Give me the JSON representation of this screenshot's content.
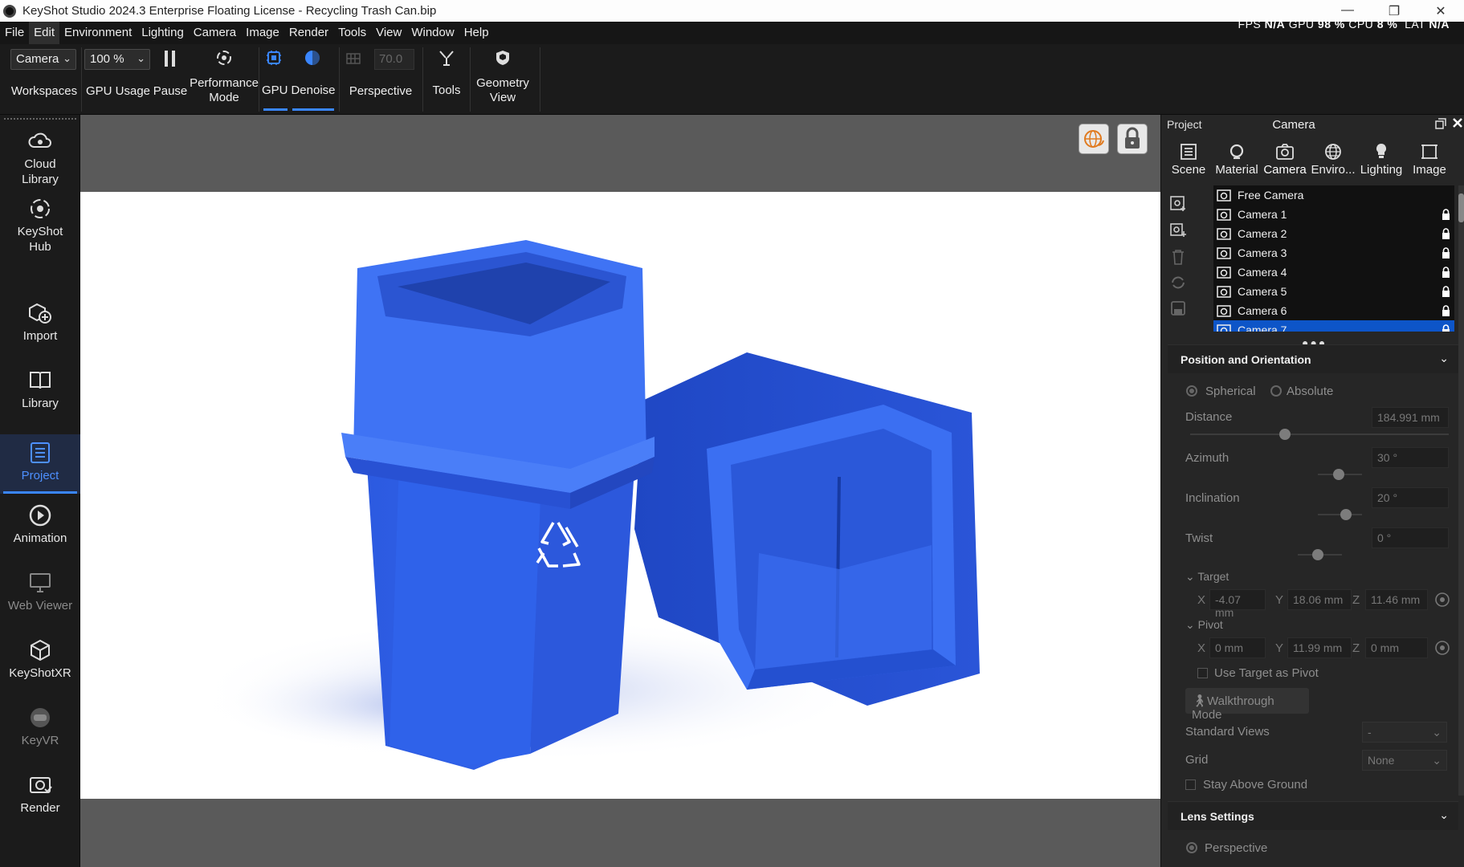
{
  "window": {
    "title": "KeyShot Studio 2024.3 Enterprise Floating License  - Recycling Trash Can.bip",
    "minimize": "—",
    "maximize": "❐",
    "close": "✕"
  },
  "menu": [
    "File",
    "Edit",
    "Environment",
    "Lighting",
    "Camera",
    "Image",
    "Render",
    "Tools",
    "View",
    "Window",
    "Help"
  ],
  "stats": {
    "fps_label": "FPS",
    "fps": "N/A",
    "gpu_label": "GPU",
    "gpu": "98 %",
    "cpu_label": "CPU",
    "cpu": "8 %",
    "lat_label": "LAT",
    "lat": "N/A"
  },
  "toolbar": {
    "workspace_select": "Camera",
    "workspaces_label": "Workspaces",
    "gpu_usage_select": "100 %",
    "gpu_usage_label": "GPU Usage",
    "pause_label": "Pause",
    "performance_label_1": "Performance",
    "performance_label_2": "Mode",
    "gpu_label": "GPU",
    "denoise_label": "Denoise",
    "fov_value": "70.0",
    "perspective_label": "Perspective",
    "tools_label": "Tools",
    "geometry_label_1": "Geometry",
    "geometry_label_2": "View"
  },
  "sidebar": {
    "items": [
      {
        "line1": "Cloud",
        "line2": "Library"
      },
      {
        "line1": "KeyShot",
        "line2": "Hub"
      },
      {
        "line1": "Import",
        "line2": ""
      },
      {
        "line1": "Library",
        "line2": ""
      },
      {
        "line1": "Project",
        "line2": ""
      },
      {
        "line1": "Animation",
        "line2": ""
      },
      {
        "line1": "Web Viewer",
        "line2": ""
      },
      {
        "line1": "KeyShotXR",
        "line2": ""
      },
      {
        "line1": "KeyVR",
        "line2": ""
      },
      {
        "line1": "Render",
        "line2": ""
      }
    ],
    "active_item": "Project"
  },
  "panel": {
    "header_left": "Project",
    "header_title": "Camera",
    "tabs": [
      "Scene",
      "Material",
      "Camera",
      "Enviro...",
      "Lighting",
      "Image"
    ],
    "active_tab": "Camera",
    "cameras": [
      "Free Camera",
      "Camera 1",
      "Camera 2",
      "Camera 3",
      "Camera 4",
      "Camera 5",
      "Camera 6",
      "Camera 7"
    ],
    "selected_camera": "Camera 7",
    "more": "●●●",
    "position_section": "Position and Orientation",
    "spherical": "Spherical",
    "absolute": "Absolute",
    "mode_selected": "Spherical",
    "distance_label": "Distance",
    "distance_value": "184.991 mm",
    "azimuth_label": "Azimuth",
    "azimuth_value": "30 °",
    "inclination_label": "Inclination",
    "inclination_value": "20 °",
    "twist_label": "Twist",
    "twist_value": "0 °",
    "target_label": "Target",
    "target_x": "-4.07 mm",
    "target_y": "18.06 mm",
    "target_z": "11.46 mm",
    "pivot_label": "Pivot",
    "pivot_x": "0 mm",
    "pivot_y": "11.99 mm",
    "pivot_z": "0 mm",
    "axis_x": "X",
    "axis_y": "Y",
    "axis_z": "Z",
    "use_target_pivot": "Use Target as Pivot",
    "walkthrough": "Walkthrough Mode",
    "standard_views_label": "Standard Views",
    "standard_views_value": "-",
    "grid_label": "Grid",
    "grid_value": "None",
    "stay_above_ground": "Stay Above Ground",
    "lens_section": "Lens Settings",
    "lens_perspective": "Perspective"
  },
  "colors": {
    "accent": "#3a86ff",
    "bin_blue": "#2f63e6",
    "bin_dark": "#1c44b8",
    "bin_light": "#5c8cff"
  }
}
